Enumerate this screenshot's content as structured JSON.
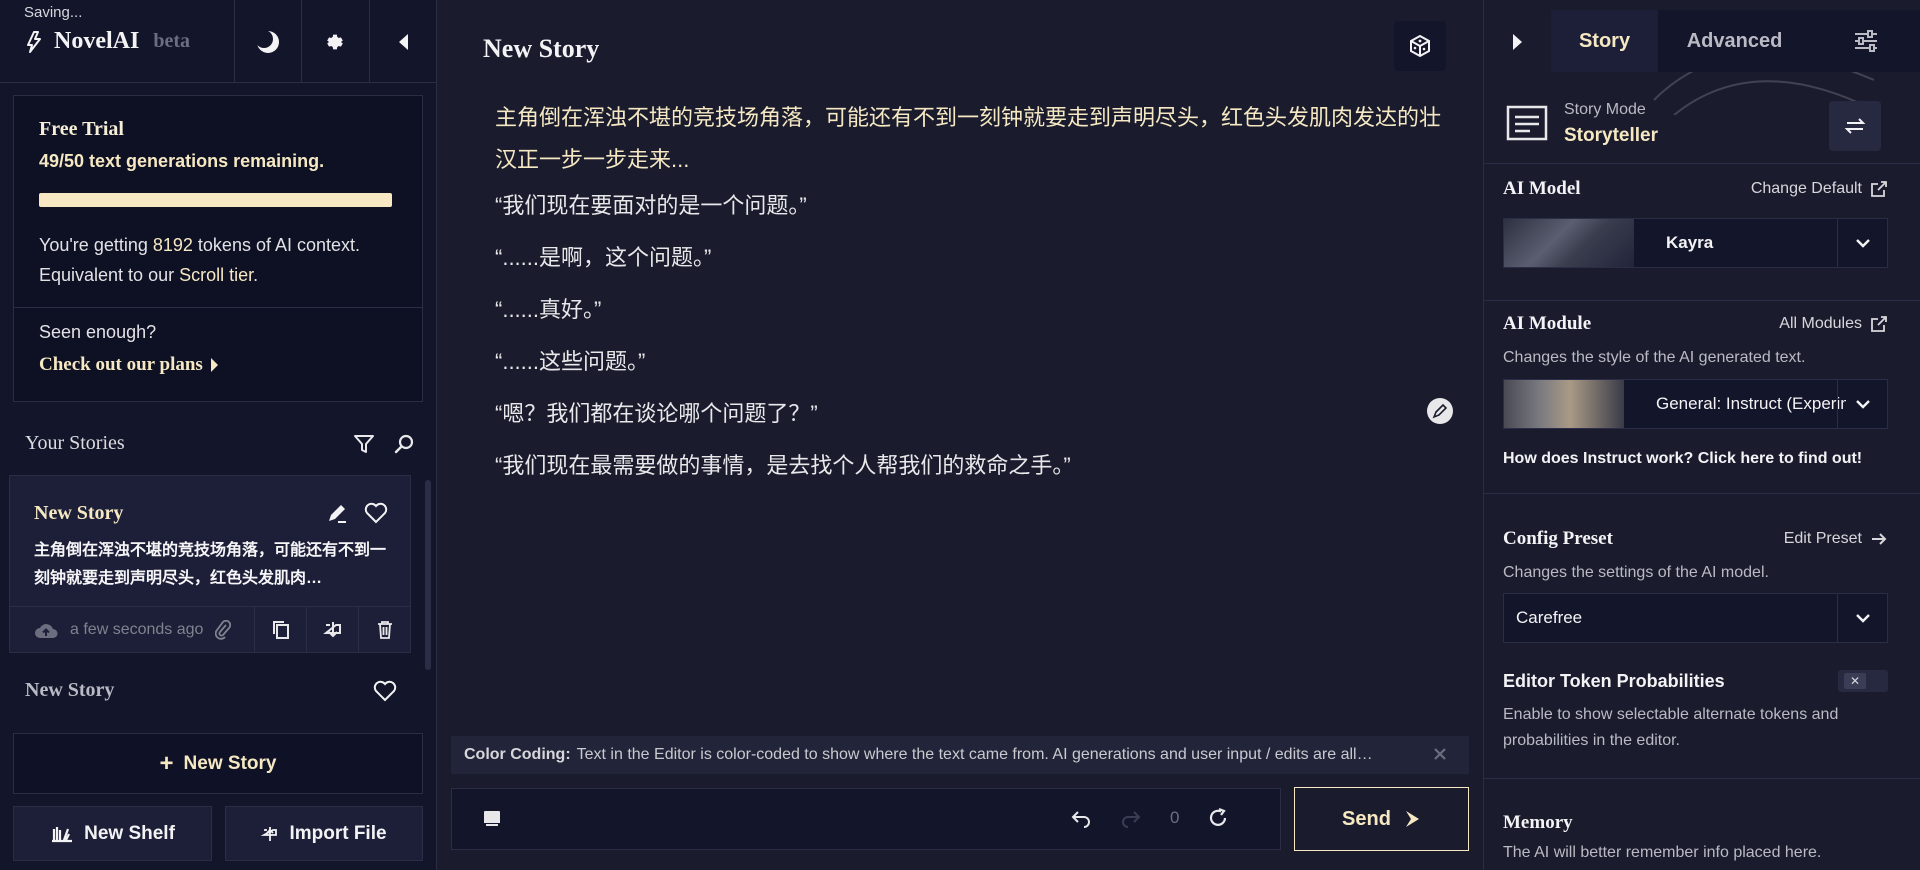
{
  "left": {
    "saving": "Saving...",
    "brand": "NovelAI",
    "beta": "beta",
    "trial": {
      "title": "Free Trial",
      "remaining": "49/50 text generations remaining.",
      "progress": 0.98,
      "ctx_pre": "You're getting ",
      "ctx_tokens": "8192",
      "ctx_post": " tokens of AI context.",
      "equiv_pre": "Equivalent to our ",
      "equiv_tier": "Scroll tier",
      "equiv_post": ".",
      "seen": "Seen enough?",
      "plans": "Check out our plans"
    },
    "stories_label": "Your Stories",
    "story_card": {
      "title": "New Story",
      "snippet": "主角倒在浑浊不堪的竞技场角落，可能还有不到一刻钟就要走到声明尽头，红色头发肌肉…",
      "time": "a few seconds ago"
    },
    "story2_title": "New Story",
    "new_story_btn": "New Story",
    "new_shelf_btn": "New Shelf",
    "import_btn": "Import File"
  },
  "center": {
    "title": "New Story",
    "paragraphs": [
      "主角倒在浑浊不堪的竞技场角落，可能还有不到一刻钟就要走到声明尽头，红色头发肌肉发达的壮汉正一步一步走来...",
      "“我们现在要面对的是一个问题。”",
      "“......是啊，这个问题。”",
      "“......真好。”",
      "“......这些问题。”",
      "“嗯？我们都在谈论哪个问题了？”",
      "“我们现在最需要做的事情，是去找个人帮我们的救命之手。”"
    ],
    "color_coding_label": "Color Coding:",
    "color_coding_text": "Text in the Editor is color-coded to show where the text came from. AI generations and user input / edits are all…",
    "retry_count": "0",
    "send_label": "Send"
  },
  "right": {
    "tabs": {
      "story": "Story",
      "advanced": "Advanced"
    },
    "mode_label": "Story Mode",
    "mode_value": "Storyteller",
    "ai_model": {
      "heading": "AI Model",
      "link": "Change Default",
      "value": "Kayra"
    },
    "ai_module": {
      "heading": "AI Module",
      "link": "All Modules",
      "desc": "Changes the style of the AI generated text.",
      "value": "General: Instruct (Experime",
      "help": "How does Instruct work? Click here to find out!"
    },
    "config_preset": {
      "heading": "Config Preset",
      "link": "Edit Preset",
      "desc": "Changes the settings of the AI model.",
      "value": "Carefree"
    },
    "token_probs": {
      "heading": "Editor Token Probabilities",
      "desc": "Enable to show selectable alternate tokens and probabilities in the editor."
    },
    "memory": {
      "heading": "Memory",
      "desc": "The AI will better remember info placed here."
    }
  },
  "colors": {
    "accent": "#f5e8c2",
    "bg": "#1a1c2e",
    "panel": "#13152b",
    "border": "#2a2d45"
  }
}
